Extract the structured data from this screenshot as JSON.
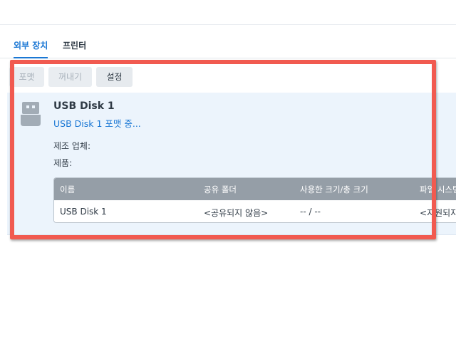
{
  "tabs": [
    {
      "label": "외부 장치",
      "active": true
    },
    {
      "label": "프린터",
      "active": false
    }
  ],
  "toolbar": {
    "format_label": "포맷",
    "eject_label": "꺼내기",
    "settings_label": "설정"
  },
  "device": {
    "icon": "usb-drive-icon",
    "name": "USB Disk 1",
    "status": "USB Disk 1 포맷 중...",
    "manufacturer_label": "제조 업체:",
    "product_label": "제품:"
  },
  "table": {
    "columns": [
      "이름",
      "공유 폴더",
      "사용한 크기/총 크기",
      "파일 시스템"
    ],
    "rows": [
      [
        "USB Disk 1",
        "<공유되지 않음>",
        "-- / --",
        "<지원되지 않음>"
      ]
    ]
  },
  "colors": {
    "accent": "#1a77d4",
    "highlight_border": "#f15a50",
    "panel_background": "#ecf4fc",
    "table_header": "#959ea7"
  }
}
